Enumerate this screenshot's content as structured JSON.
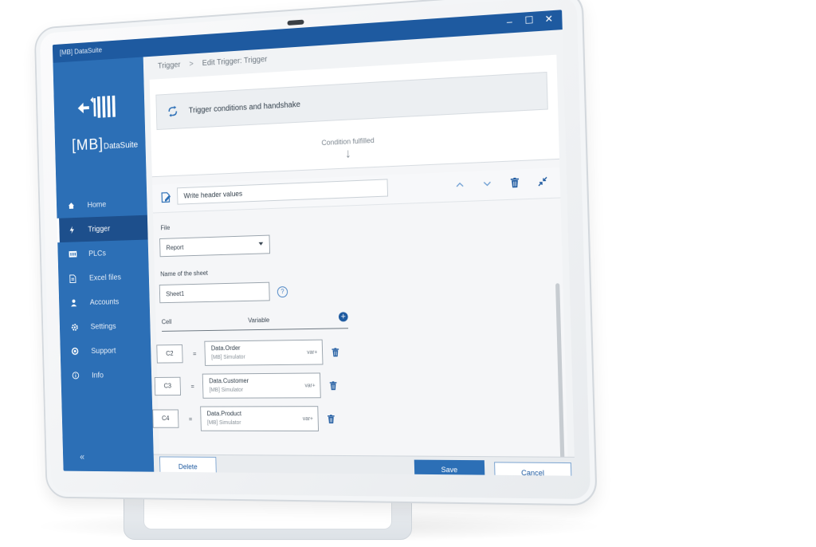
{
  "app": {
    "title": "[MB] DataSuite"
  },
  "window_controls": {
    "minimize": "–",
    "maximize": "☐",
    "close": "✕"
  },
  "logo": {
    "mark_text": "[MB]",
    "name": "DataSuite"
  },
  "sidebar": {
    "items": [
      {
        "label": "Home",
        "icon": "home-icon"
      },
      {
        "label": "Trigger",
        "icon": "lightning-icon",
        "active": true
      },
      {
        "label": "PLCs",
        "icon": "plc-icon"
      },
      {
        "label": "Excel files",
        "icon": "file-icon"
      },
      {
        "label": "Accounts",
        "icon": "user-icon"
      },
      {
        "label": "Settings",
        "icon": "gear-icon"
      },
      {
        "label": "Support",
        "icon": "support-icon"
      },
      {
        "label": "Info",
        "icon": "info-icon"
      }
    ],
    "collapse": "«"
  },
  "breadcrumb": {
    "root": "Trigger",
    "separator": ">",
    "current": "Edit Trigger: Trigger"
  },
  "condition": {
    "label": "Trigger conditions and handshake"
  },
  "flow": {
    "label": "Condition fulfilled",
    "arrow": "↓"
  },
  "action": {
    "name": "Write header values",
    "file_label": "File",
    "file_value": "Report",
    "sheet_label": "Name of the sheet",
    "sheet_value": "Sheet1",
    "help": "?"
  },
  "table": {
    "col_cell": "Cell",
    "col_variable": "Variable",
    "add": "+",
    "equals": "=",
    "rows": [
      {
        "cell": "C2",
        "variable": "Data.Order",
        "source": "[MB] Simulator",
        "var_add": "var+"
      },
      {
        "cell": "C3",
        "variable": "Data.Customer",
        "source": "[MB] Simulator",
        "var_add": "var+"
      },
      {
        "cell": "C4",
        "variable": "Data.Product",
        "source": "[MB] Simulator",
        "var_add": "var+"
      }
    ]
  },
  "footer": {
    "delete": "Delete",
    "save": "Save",
    "cancel": "Cancel"
  },
  "colors": {
    "primary": "#2c6fb6",
    "primary_dark": "#1e5aa0",
    "active": "#1d4f8c"
  }
}
